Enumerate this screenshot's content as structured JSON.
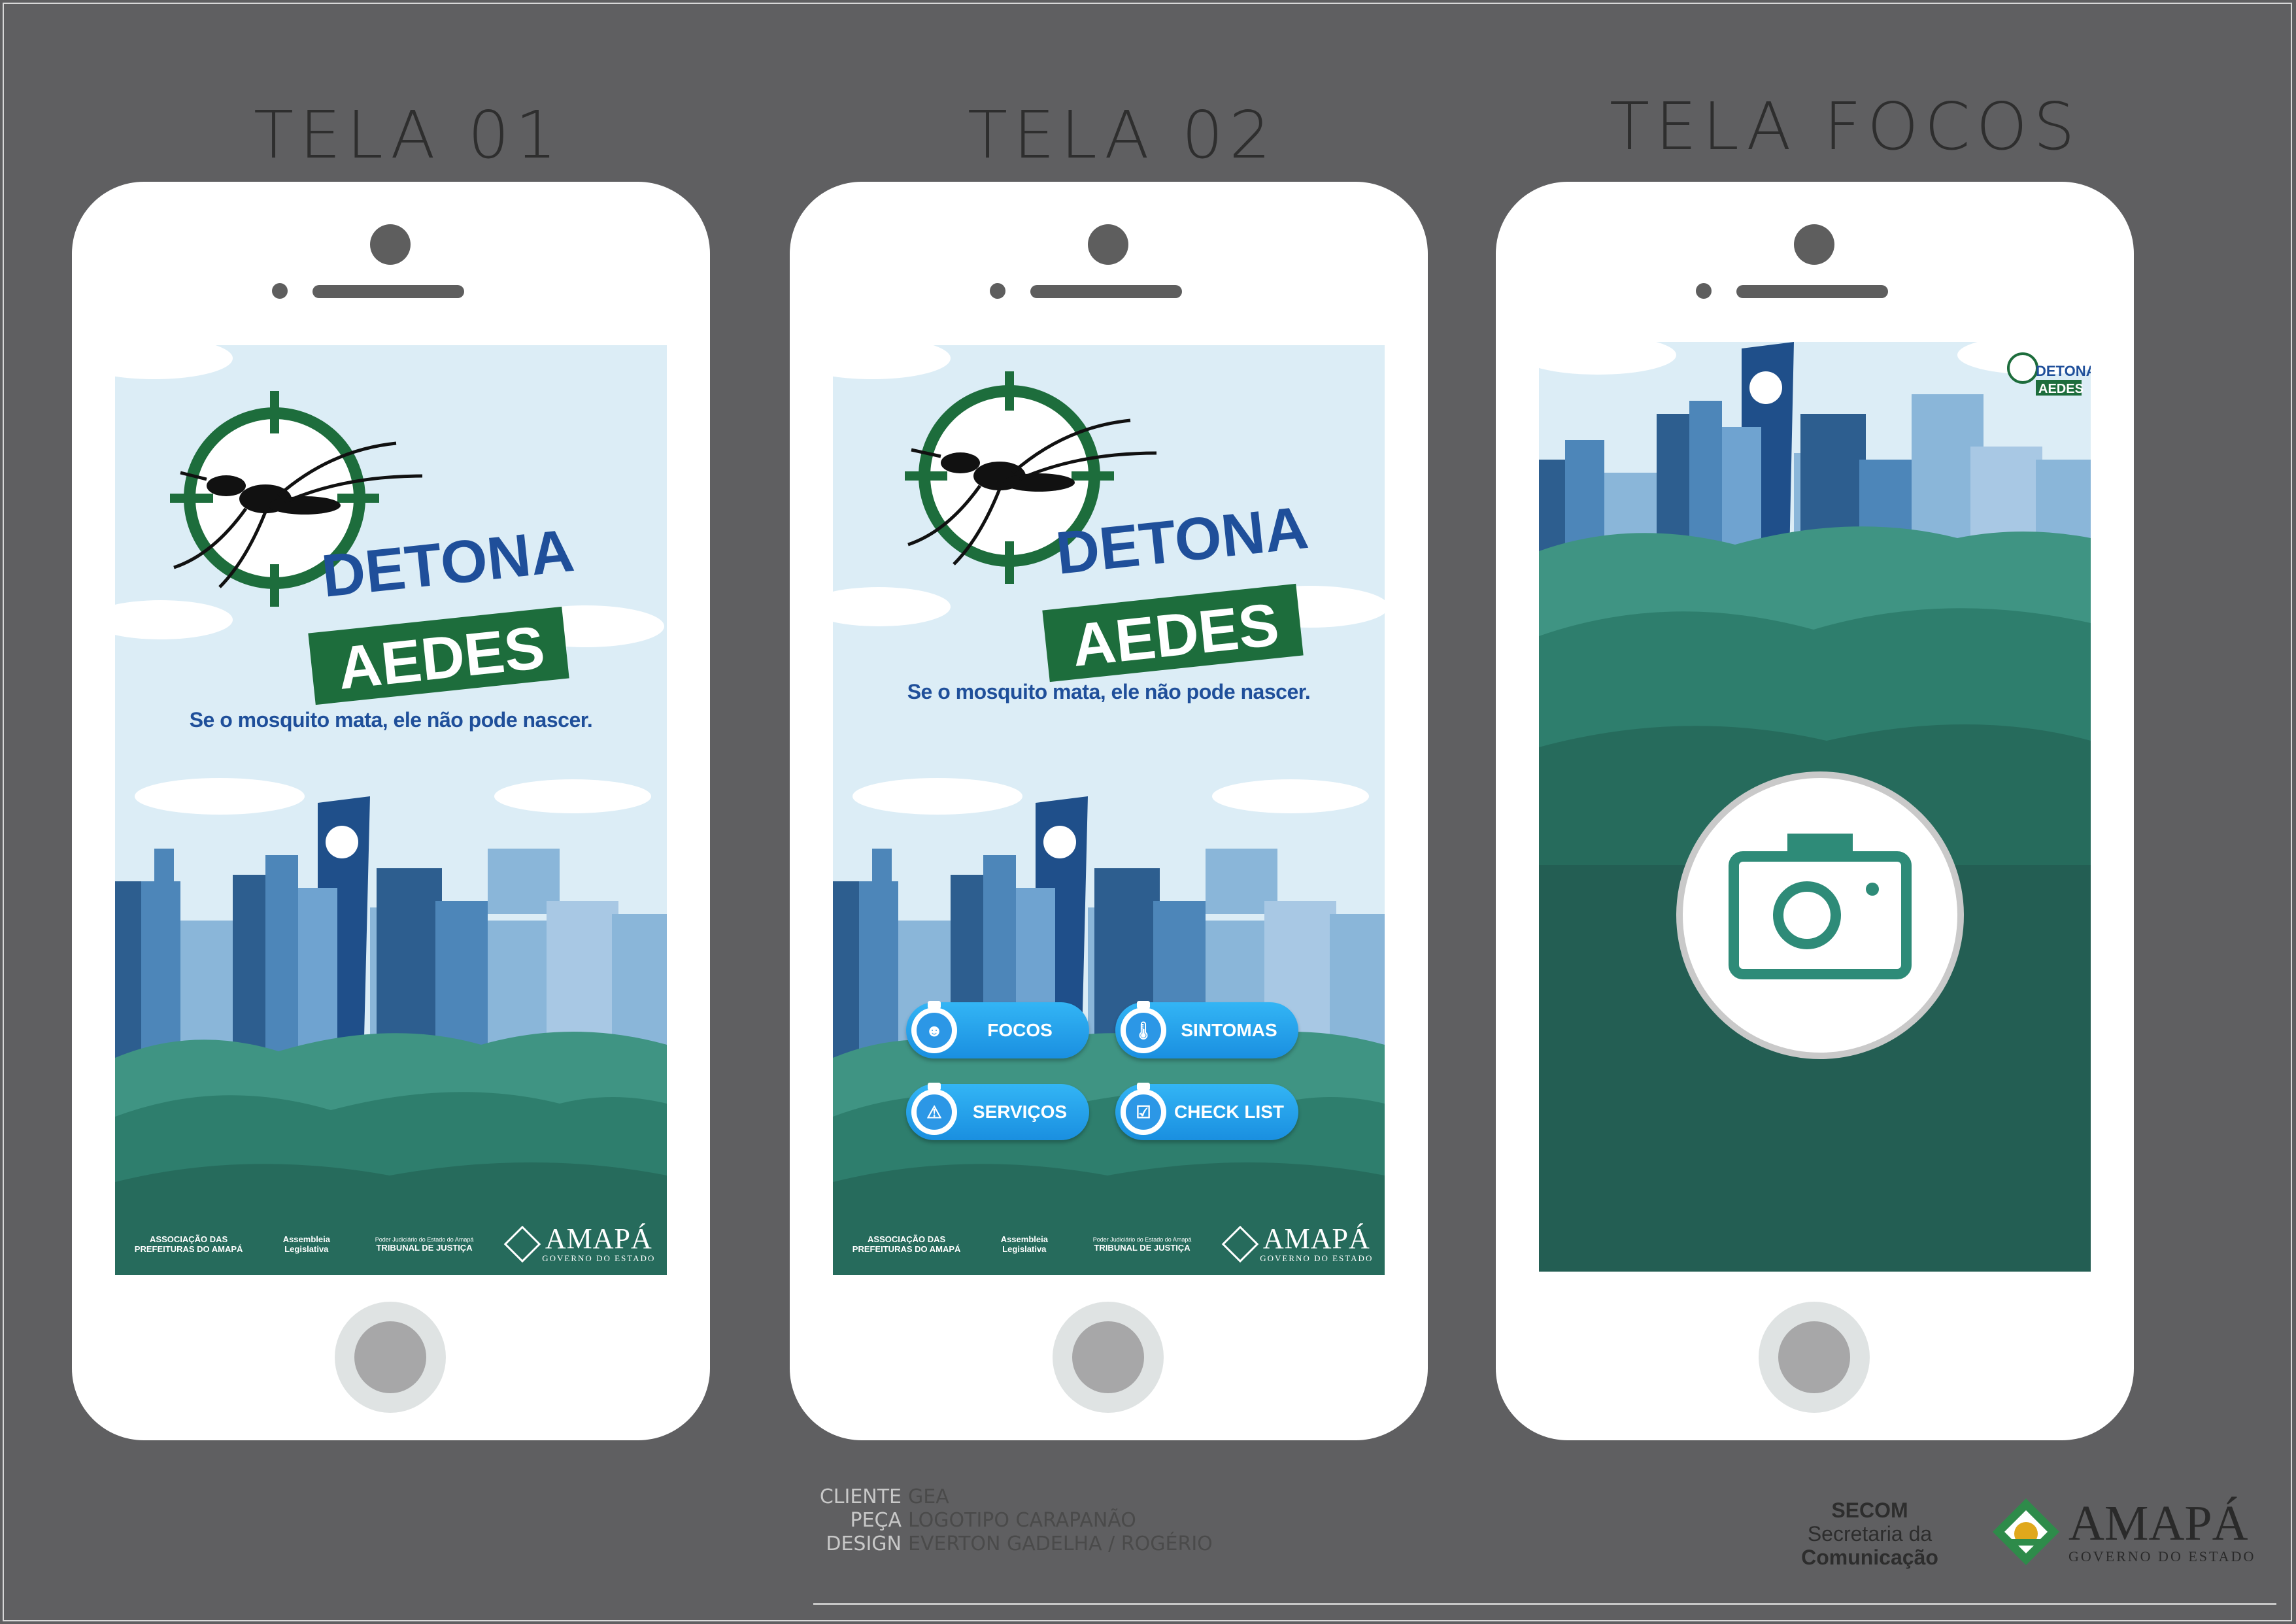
{
  "screens": [
    {
      "title": "TELA 01",
      "tagline": "Se o mosquito mata, ele não pode nascer.",
      "logo_line1": "DETONA",
      "logo_line2": "AEDES"
    },
    {
      "title": "TELA 02",
      "tagline": "Se o mosquito mata, ele não pode nascer.",
      "logo_line1": "DETONA",
      "logo_line2": "AEDES",
      "menu": [
        {
          "label": "FOCOS",
          "icon": "people-icon"
        },
        {
          "label": "SINTOMAS",
          "icon": "thermometer-icon"
        },
        {
          "label": "SERVIÇOS",
          "icon": "warning-icon"
        },
        {
          "label": "CHECK LIST",
          "icon": "checkbox-icon"
        }
      ]
    },
    {
      "title": "TELA FOCOS",
      "logo_line1": "DETONA",
      "logo_line2": "AEDES",
      "camera_icon": "camera-icon"
    }
  ],
  "footer_logos": {
    "assoc": "ASSOCIAÇÃO DAS PREFEITURAS DO AMAPÁ",
    "assembleia": "Assembleia Legislativa",
    "tribunal_small": "Poder Judiciário do Estado do Amapá",
    "tribunal": "TRIBUNAL DE JUSTIÇA",
    "amapa": "AMAPÁ",
    "governo": "GOVERNO DO ESTADO"
  },
  "credits": [
    {
      "key": "CLIENTE",
      "value": "GEA"
    },
    {
      "key": "PEÇA",
      "value": "LOGOTIPO CARAPANÃO"
    },
    {
      "key": "DESIGN",
      "value": "EVERTON GADELHA / ROGÉRIO"
    }
  ],
  "secom": {
    "line1": "SECOM",
    "line2": "Secretaria da",
    "line3": "Comunicação"
  },
  "gov_logo": {
    "word": "AMAPÁ",
    "sub": "GOVERNO DO ESTADO"
  },
  "colors": {
    "background": "#5f5f61",
    "sky": "#dcedf6",
    "forest": "#2e7e6d",
    "navy": "#1f4f9a",
    "green": "#1d6d3c",
    "button": "#1a8fe0"
  }
}
